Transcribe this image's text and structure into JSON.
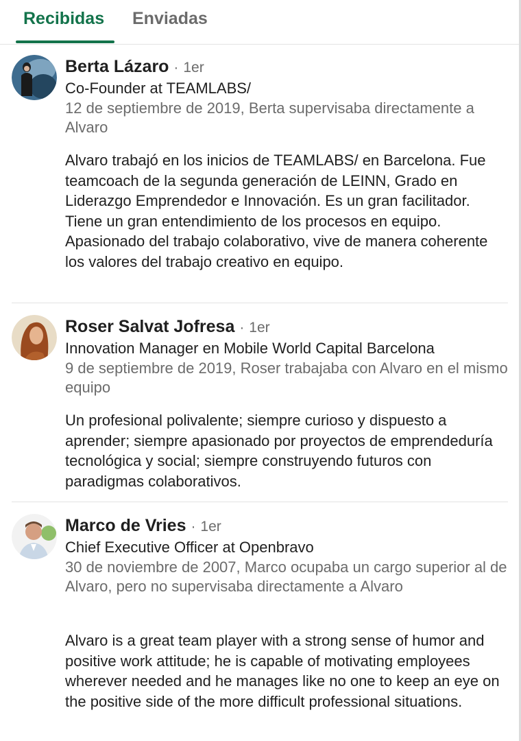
{
  "tabs": {
    "received": "Recibidas",
    "sent": "Enviadas"
  },
  "recommendations": [
    {
      "name": "Berta Lázaro",
      "separator": "·",
      "degree": "1er",
      "headline": "Co-Founder at TEAMLABS/",
      "meta": "12 de septiembre de 2019, Berta supervisaba directamente a Alvaro",
      "text": "Alvaro trabajó en los inicios de TEAMLABS/ en Barcelona. Fue teamcoach de la segunda generación de LEINN, Grado en Liderazgo Emprendedor e Innovación. Es un gran facilitador. Tiene un gran entendimiento de los procesos en equipo. Apasionado del trabajo colaborativo, vive de manera coherente los valores del trabajo creativo en equipo."
    },
    {
      "name": "Roser Salvat Jofresa",
      "separator": "·",
      "degree": "1er",
      "headline": "Innovation Manager en Mobile World Capital Barcelona",
      "meta": "9 de septiembre de 2019, Roser trabajaba con Alvaro en el mismo equipo",
      "text": "Un profesional polivalente; siempre curioso y dispuesto a aprender; siempre apasionado por proyectos de emprendeduría tecnológica y social; siempre construyendo futuros con paradigmas colaborativos."
    },
    {
      "name": "Marco de Vries",
      "separator": "·",
      "degree": "1er",
      "headline": "Chief Executive Officer at Openbravo",
      "meta": "30 de noviembre de 2007, Marco ocupaba un cargo superior al de Alvaro, pero no supervisaba directamente a Alvaro",
      "text": "Alvaro is a great team player with a strong sense of humor and positive work attitude; he is capable of motivating employees wherever needed and he manages like no one to keep an eye on the positive side of the more difficult professional situations."
    }
  ],
  "colors": {
    "accent": "#13734b",
    "muted": "#6b6b6b",
    "text": "#1f1f1f",
    "divider": "#e3e3e3"
  }
}
